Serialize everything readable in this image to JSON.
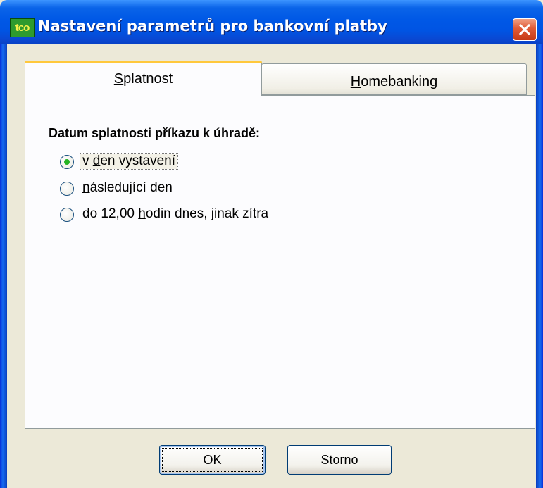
{
  "window": {
    "title": "Nastavení parametrů pro bankovní platby",
    "app_icon_text": "tco",
    "close_icon": "close-icon"
  },
  "tabs": [
    {
      "label": "Splatnost",
      "mnemonic": "S",
      "rest": "platnost",
      "active": true
    },
    {
      "label": "Homebanking",
      "mnemonic": "H",
      "rest": "omebanking",
      "active": false
    }
  ],
  "due_date": {
    "group_label": "Datum splatnosti příkazu k úhradě:",
    "options": [
      {
        "label": "v den vystavení",
        "pre": "v ",
        "mnemonic": "d",
        "post": "en vystavení",
        "checked": true
      },
      {
        "label": "následující den",
        "pre": "",
        "mnemonic": "n",
        "post": "ásledující den",
        "checked": false
      },
      {
        "label": "do 12,00 hodin dnes, jinak zítra",
        "pre": "do 12,00 ",
        "mnemonic": "h",
        "post": "odin dnes, jinak zítra",
        "checked": false
      }
    ]
  },
  "buttons": {
    "ok_label": "OK",
    "cancel_label": "Storno"
  },
  "colors": {
    "titlebar": "#0054e3",
    "tab_accent": "#ffc83c",
    "radio_dot": "#24b324",
    "close_button": "#e05a36"
  }
}
